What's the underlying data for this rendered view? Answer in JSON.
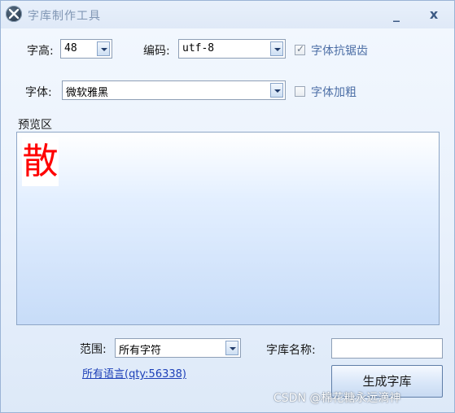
{
  "window": {
    "title": "字库制作工具",
    "minimize_glyph": "_",
    "close_glyph": "x"
  },
  "height_field": {
    "label": "字高:",
    "value": "48"
  },
  "encoding_field": {
    "label": "编码:",
    "value": "utf-8"
  },
  "antialias": {
    "label": "字体抗锯齿",
    "checked": true
  },
  "font_field": {
    "label": "字体:",
    "value": "微软雅黑"
  },
  "bold": {
    "label": "字体加粗",
    "checked": false
  },
  "preview": {
    "label": "预览区",
    "char": "散",
    "char_color": "#ff0000"
  },
  "range_field": {
    "label": "范围:",
    "value": "所有字符"
  },
  "lib_name_field": {
    "label": "字库名称:",
    "value": ""
  },
  "all_lang_link": "所有语言(qty:56338)",
  "generate_button": "生成字库",
  "watermark": "CSDN @棉花糖永远滴神",
  "colors": {
    "accent_link": "#1c3fb8",
    "check_label": "#4d6fa6",
    "preview_char": "#ff0000"
  }
}
